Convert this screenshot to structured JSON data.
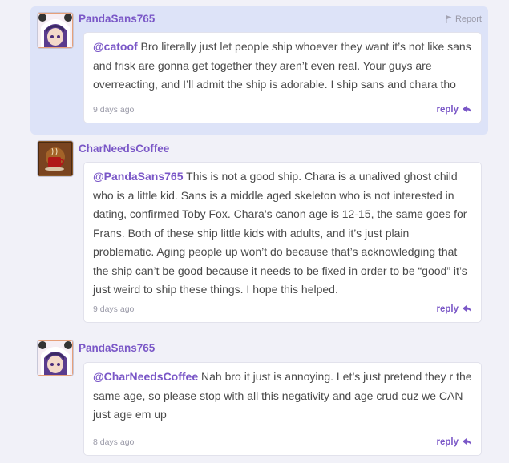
{
  "report_label": "Report",
  "reply_label": "reply",
  "comments": [
    {
      "username": "PandaSans765",
      "mention": "@catoof",
      "text": " Bro literally just let people ship whoever they want it’s not like sans and frisk are gonna get together they aren’t even real. Your guys are overreacting, and I’ll admit the ship is adorable. I ship sans and chara tho",
      "time": "9 days ago"
    },
    {
      "username": "CharNeedsCoffee",
      "mention": "@PandaSans765",
      "text": " This is not a good ship. Chara is a unalived ghost child who is a little kid. Sans is a middle aged skeleton who is not interested in dating, confirmed Toby Fox. Chara’s canon age is 12-15, the same goes for Frans. Both of these ship little kids with adults, and it’s just plain problematic. Aging people up won’t do because that’s acknowledging that the ship can’t be good because it needs to be fixed in order to be “good” it’s just weird to ship these things. I hope this helped.",
      "time": "9 days ago"
    },
    {
      "username": "PandaSans765",
      "mention": "@CharNeedsCoffee",
      "text": " Nah bro it just is annoying. Let’s just pretend they r the same age, so please stop with all this negativity and age crud cuz we CAN just age em up",
      "time": "8 days ago"
    }
  ]
}
